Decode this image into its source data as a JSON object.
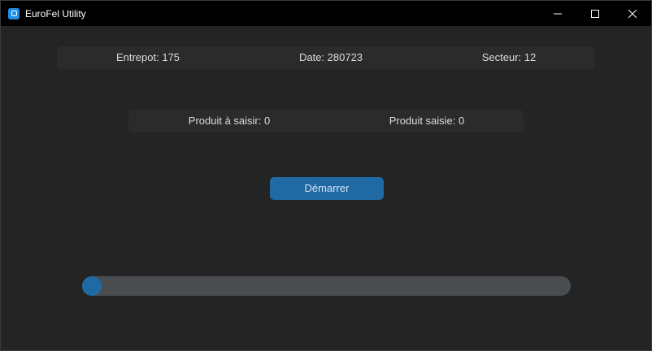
{
  "window": {
    "title": "EuroFel Utility",
    "accent_color": "#1f6aa5",
    "icons": [
      "app-icon",
      "minimize-icon",
      "maximize-icon",
      "close-icon"
    ]
  },
  "info": {
    "entrepot": "Entrepot: 175",
    "date": "Date: 280723",
    "secteur": "Secteur: 12"
  },
  "products": {
    "a_saisir": "Produit à saisir: 0",
    "saisie": "Produit saisie: 0"
  },
  "actions": {
    "start_label": "Démarrer"
  },
  "progress": {
    "value": 0.0
  }
}
